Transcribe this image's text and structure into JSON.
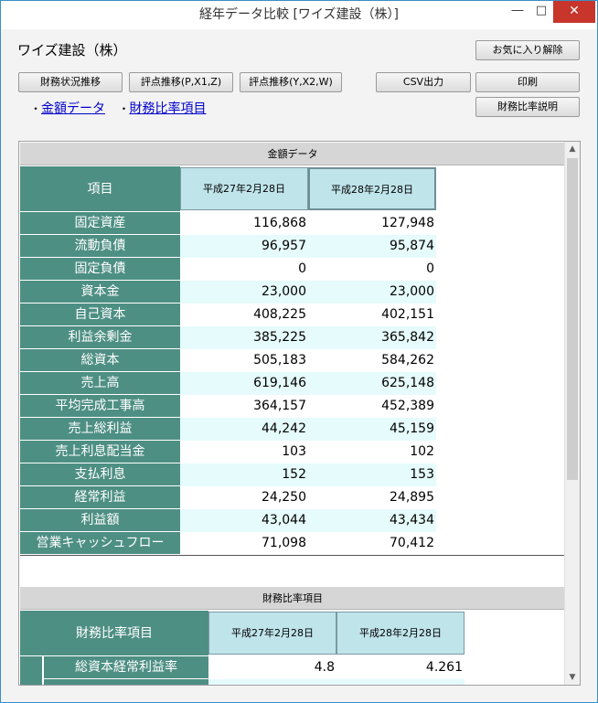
{
  "window": {
    "title": "経年データ比較 [ワイズ建設（株）]",
    "minimize": "―",
    "maximize": "□",
    "close": "✕"
  },
  "company_name": "ワイズ建設（株）",
  "toolbar": {
    "favorite_remove": "お気に入り解除",
    "financial_trend": "財務状況推移",
    "score_pxz": "評点推移(P,X1,Z)",
    "score_yxw": "評点推移(Y,X2,W)",
    "csv_export": "CSV出力",
    "print": "印刷",
    "ratio_explain": "財務比率説明"
  },
  "links": {
    "bullet": "・",
    "amount_data": "金額データ",
    "ratio_items": "財務比率項目"
  },
  "amount_section": {
    "title": "金額データ",
    "item_header": "項目",
    "periods": [
      "平成27年2月28日",
      "平成28年2月28日"
    ],
    "rows": [
      {
        "label": "固定資産",
        "v1": "116,868",
        "v2": "127,948"
      },
      {
        "label": "流動負債",
        "v1": "96,957",
        "v2": "95,874"
      },
      {
        "label": "固定負債",
        "v1": "0",
        "v2": "0"
      },
      {
        "label": "資本金",
        "v1": "23,000",
        "v2": "23,000"
      },
      {
        "label": "自己資本",
        "v1": "408,225",
        "v2": "402,151"
      },
      {
        "label": "利益余剰金",
        "v1": "385,225",
        "v2": "365,842"
      },
      {
        "label": "総資本",
        "v1": "505,183",
        "v2": "584,262"
      },
      {
        "label": "売上高",
        "v1": "619,146",
        "v2": "625,148"
      },
      {
        "label": "平均完成工事高",
        "v1": "364,157",
        "v2": "452,389"
      },
      {
        "label": "売上総利益",
        "v1": "44,242",
        "v2": "45,159"
      },
      {
        "label": "売上利息配当金",
        "v1": "103",
        "v2": "102"
      },
      {
        "label": "支払利息",
        "v1": "152",
        "v2": "153"
      },
      {
        "label": "経常利益",
        "v1": "24,250",
        "v2": "24,895"
      },
      {
        "label": "利益額",
        "v1": "43,044",
        "v2": "43,434"
      },
      {
        "label": "営業キャッシュフロー",
        "v1": "71,098",
        "v2": "70,412"
      }
    ]
  },
  "ratio_section": {
    "title": "財務比率項目",
    "item_header": "財務比率項目",
    "periods": [
      "平成27年2月28日",
      "平成28年2月28日"
    ],
    "rows": [
      {
        "label": "総資本経常利益率",
        "v1": "4.8",
        "v2": "4.261"
      }
    ]
  },
  "colors": {
    "label_bg": "#4e8f84",
    "header_bg": "#bfe4ea",
    "row_alt": "#e6fbfb",
    "link": "#0000cc",
    "close_button": "#c7352b"
  }
}
